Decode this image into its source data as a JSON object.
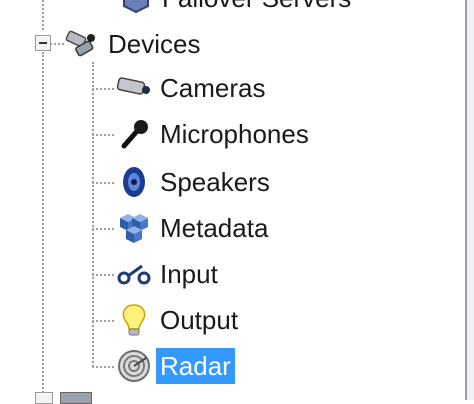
{
  "tree": {
    "top_partial_label": "Failover Servers",
    "parent": {
      "label": "Devices",
      "icon": "camera-group-icon",
      "expanded": true
    },
    "children": [
      {
        "label": "Cameras",
        "icon": "camera-icon"
      },
      {
        "label": "Microphones",
        "icon": "microphone-icon"
      },
      {
        "label": "Speakers",
        "icon": "speaker-icon"
      },
      {
        "label": "Metadata",
        "icon": "metadata-cubes-icon"
      },
      {
        "label": "Input",
        "icon": "input-switch-icon"
      },
      {
        "label": "Output",
        "icon": "lightbulb-icon"
      },
      {
        "label": "Radar",
        "icon": "radar-icon",
        "selected": true
      }
    ],
    "selection_color": "#3399ff"
  }
}
